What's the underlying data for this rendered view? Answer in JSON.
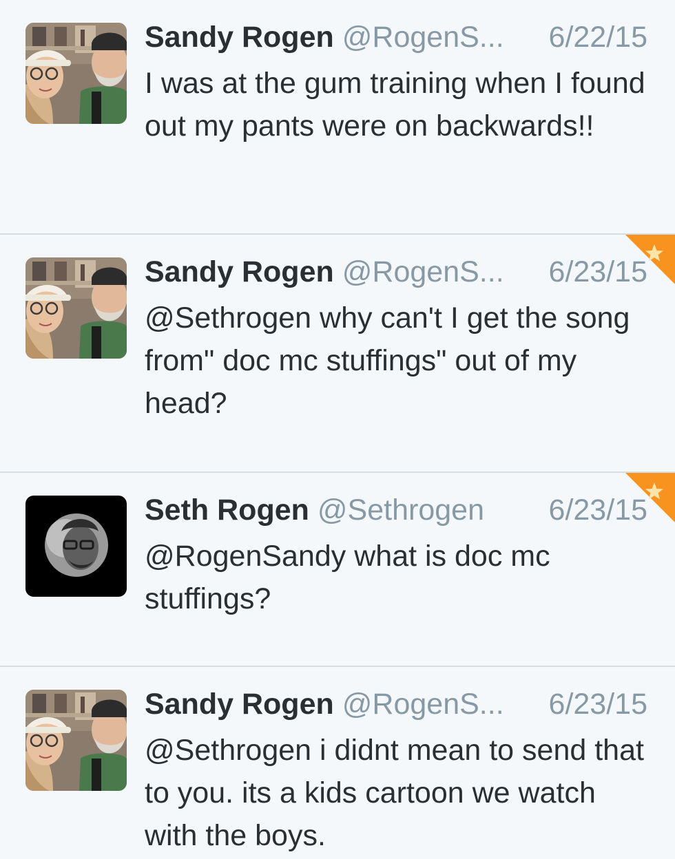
{
  "tweets": [
    {
      "name": "Sandy Rogen",
      "handle": "@RogenS...",
      "date": "6/22/15",
      "text": "I was at the gum training when I found out my pants were on backwards!!",
      "favorited": false,
      "avatar": "couple-photo"
    },
    {
      "name": "Sandy Rogen",
      "handle": "@RogenS...",
      "date": "6/23/15",
      "text": "@Sethrogen why can't I get the song from\" doc mc stuffings\" out of my head?",
      "favorited": true,
      "avatar": "couple-photo"
    },
    {
      "name": "Seth Rogen",
      "handle": "@Sethrogen",
      "date": "6/23/15",
      "text": "@RogenSandy what is doc mc stuffings?",
      "favorited": true,
      "avatar": "bw-portrait"
    },
    {
      "name": "Sandy Rogen",
      "handle": "@RogenS...",
      "date": "6/23/15",
      "text": "@Sethrogen i didnt mean to send that to you. its a kids cartoon we watch with the boys.",
      "favorited": false,
      "avatar": "couple-photo"
    }
  ],
  "colors": {
    "background": "#f5f8fa",
    "divider": "#d8dde2",
    "name": "#292f33",
    "meta": "#8899a6",
    "favorite_accent": "#f7931e"
  }
}
